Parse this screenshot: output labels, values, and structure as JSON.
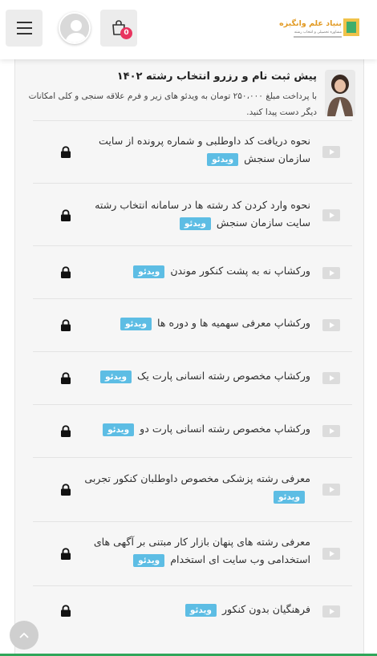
{
  "header": {
    "menu_icon": "hamburger-menu-icon",
    "avatar_icon": "user-avatar-icon",
    "cart_icon": "shopping-bag-icon",
    "cart_count": "0",
    "logo_text": "بنیاد علم وانگیزه",
    "logo_subtext": "مشاوره تحصیلی و انتخاب رشته"
  },
  "course": {
    "title": "پیش ثبت نام و رزرو انتخاب رشته ۱۴۰۲",
    "description": "با پرداخت مبلغ ۲۵۰،۰۰۰ تومان به ویدئو های زیر و فرم علاقه سنجی و کلی امکانات دیگر دست پیدا کنید."
  },
  "lessons": [
    {
      "title": "نحوه دریافت کد داوطلبی و شماره پرونده از سایت سازمان سنجش",
      "badge": "ویدئو"
    },
    {
      "title": "نحوه وارد کردن کد رشته ها در سامانه انتخاب رشته سایت سازمان سنجش",
      "badge": "ویدئو"
    },
    {
      "title": "ورکشاپ نه به پشت کنکور موندن",
      "badge": "ویدئو"
    },
    {
      "title": "ورکشاپ معرفی سهمیه ها و دوره ها",
      "badge": "ویدئو"
    },
    {
      "title": "ورکشاپ مخصوص رشته انسانی پارت یک",
      "badge": "ویدئو"
    },
    {
      "title": "ورکشاپ مخصوص رشته انسانی پارت دو",
      "badge": "ویدئو"
    },
    {
      "title": "معرفی رشته پزشکی مخصوص داوطلبان کنکور تجربی",
      "badge": "ویدئو"
    },
    {
      "title": "معرفی رشته های پنهان بازار کار مبتنی بر آگهی های استخدامی وب سایت ای استخدام",
      "badge": "ویدئو"
    },
    {
      "title": "فرهنگیان بدون کنکور",
      "badge": "ویدئو"
    }
  ],
  "icons": {
    "play": "video-play-icon",
    "lock": "lock-icon",
    "scroll_top": "chevron-up-icon"
  },
  "colors": {
    "badge": "#5dbde4",
    "cart_badge": "#e8345f",
    "accent_line": "#2fa65a"
  }
}
